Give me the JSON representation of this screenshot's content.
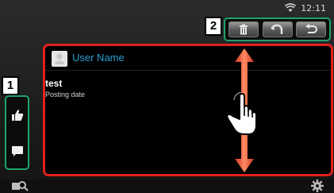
{
  "status_bar": {
    "time": "12:11",
    "wifi_icon": "wifi-icon"
  },
  "callouts": {
    "one": "1",
    "two": "2"
  },
  "top_buttons": [
    {
      "icon": "trash-icon"
    },
    {
      "icon": "reply-arrow-icon"
    },
    {
      "icon": "back-icon"
    }
  ],
  "side_buttons": [
    {
      "icon": "thumbs-up-icon"
    },
    {
      "icon": "comment-icon"
    }
  ],
  "post": {
    "user_name": "User Name",
    "text": "test",
    "posting_date": "Posting date"
  },
  "colors": {
    "accent_green": "#1ea36b",
    "highlight_red": "#e0201d",
    "username_blue": "#2a9fd6"
  }
}
